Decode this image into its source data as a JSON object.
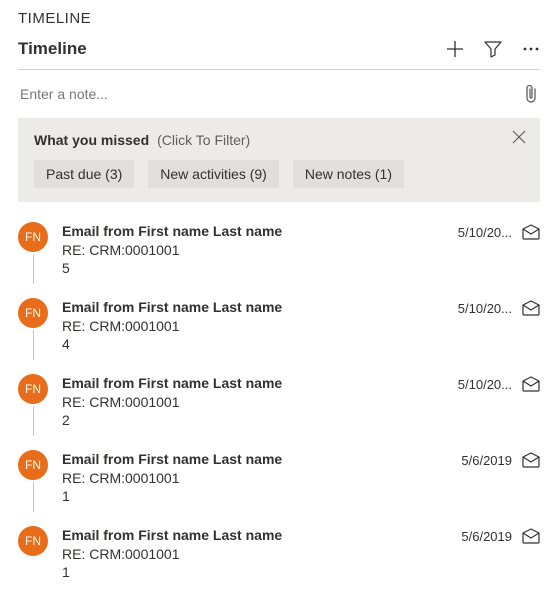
{
  "page_title": "TIMELINE",
  "header": {
    "title": "Timeline"
  },
  "note": {
    "placeholder": "Enter a note..."
  },
  "missed": {
    "title": "What you missed",
    "subtitle": "(Click To Filter)",
    "chips": [
      {
        "label": "Past due (3)"
      },
      {
        "label": "New activities (9)"
      },
      {
        "label": "New notes (1)"
      }
    ]
  },
  "avatar_initials": "FN",
  "items": [
    {
      "title": "Email from First name Last name",
      "subject": "RE: CRM:0001001",
      "num": "5",
      "date": "5/10/20..."
    },
    {
      "title": "Email from First name Last name",
      "subject": "RE: CRM:0001001",
      "num": "4",
      "date": "5/10/20..."
    },
    {
      "title": "Email from First name Last name",
      "subject": "RE: CRM:0001001",
      "num": "2",
      "date": "5/10/20..."
    },
    {
      "title": "Email from First name Last name",
      "subject": "RE: CRM:0001001",
      "num": "1",
      "date": "5/6/2019"
    },
    {
      "title": "Email from First name Last name",
      "subject": "RE: CRM:0001001",
      "num": "1",
      "date": "5/6/2019"
    }
  ]
}
